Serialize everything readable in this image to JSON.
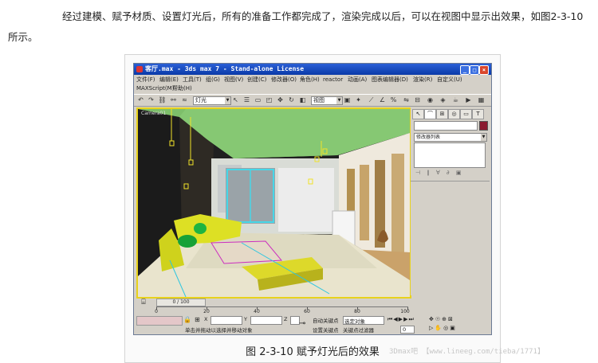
{
  "paragraph": "经过建模、赋予材质、设置灯光后，所有的准备工作都完成了，渲染完成以后，可以在视图中显示出效果，如图2-3-10所示。",
  "window": {
    "title": "客厅.max - 3ds max 7 - Stand-alone License",
    "menu": [
      "文件(F)",
      "编辑(E)",
      "工具(T)",
      "组(G)",
      "视图(V)",
      "创建(C)",
      "修改器(O)",
      "角色(H)",
      "reactor",
      "动画(A)",
      "图表编辑器(D)",
      "渲染(R)",
      "自定义(U)"
    ],
    "menu_row2": [
      "MAXScript(M)",
      "帮助(H)"
    ],
    "toolbar": {
      "filter_combo": "灯光",
      "view_combo": "视图"
    },
    "viewport_label": "Camera01",
    "panel": {
      "modifier_list": "修改器列表"
    },
    "timeline": {
      "frame": "0 / 100",
      "ticks": [
        "0",
        "20",
        "40",
        "60",
        "80",
        "100"
      ]
    },
    "status": {
      "prompt": "单击并拖动以选择并移动对象",
      "auto_key": "自动关键点",
      "set_key": "设置关键点",
      "selected_combo": "选定对象",
      "key_filters": "关键点过滤器",
      "x_label": "X",
      "y_label": "Y",
      "z_label": "Z",
      "frame_field": "0"
    }
  },
  "caption": "图 2-3-10   赋予灯光后的效果",
  "watermark": "3Dmax吧 【www.lineeg.com/tieba/1771】"
}
